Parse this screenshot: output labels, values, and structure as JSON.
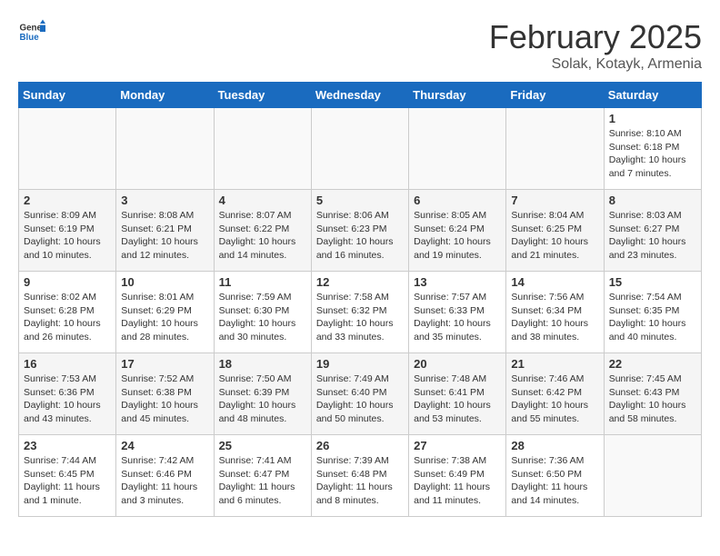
{
  "header": {
    "logo_general": "General",
    "logo_blue": "Blue",
    "title": "February 2025",
    "subtitle": "Solak, Kotayk, Armenia"
  },
  "weekdays": [
    "Sunday",
    "Monday",
    "Tuesday",
    "Wednesday",
    "Thursday",
    "Friday",
    "Saturday"
  ],
  "weeks": [
    [
      {
        "day": "",
        "info": ""
      },
      {
        "day": "",
        "info": ""
      },
      {
        "day": "",
        "info": ""
      },
      {
        "day": "",
        "info": ""
      },
      {
        "day": "",
        "info": ""
      },
      {
        "day": "",
        "info": ""
      },
      {
        "day": "1",
        "info": "Sunrise: 8:10 AM\nSunset: 6:18 PM\nDaylight: 10 hours and 7 minutes."
      }
    ],
    [
      {
        "day": "2",
        "info": "Sunrise: 8:09 AM\nSunset: 6:19 PM\nDaylight: 10 hours and 10 minutes."
      },
      {
        "day": "3",
        "info": "Sunrise: 8:08 AM\nSunset: 6:21 PM\nDaylight: 10 hours and 12 minutes."
      },
      {
        "day": "4",
        "info": "Sunrise: 8:07 AM\nSunset: 6:22 PM\nDaylight: 10 hours and 14 minutes."
      },
      {
        "day": "5",
        "info": "Sunrise: 8:06 AM\nSunset: 6:23 PM\nDaylight: 10 hours and 16 minutes."
      },
      {
        "day": "6",
        "info": "Sunrise: 8:05 AM\nSunset: 6:24 PM\nDaylight: 10 hours and 19 minutes."
      },
      {
        "day": "7",
        "info": "Sunrise: 8:04 AM\nSunset: 6:25 PM\nDaylight: 10 hours and 21 minutes."
      },
      {
        "day": "8",
        "info": "Sunrise: 8:03 AM\nSunset: 6:27 PM\nDaylight: 10 hours and 23 minutes."
      }
    ],
    [
      {
        "day": "9",
        "info": "Sunrise: 8:02 AM\nSunset: 6:28 PM\nDaylight: 10 hours and 26 minutes."
      },
      {
        "day": "10",
        "info": "Sunrise: 8:01 AM\nSunset: 6:29 PM\nDaylight: 10 hours and 28 minutes."
      },
      {
        "day": "11",
        "info": "Sunrise: 7:59 AM\nSunset: 6:30 PM\nDaylight: 10 hours and 30 minutes."
      },
      {
        "day": "12",
        "info": "Sunrise: 7:58 AM\nSunset: 6:32 PM\nDaylight: 10 hours and 33 minutes."
      },
      {
        "day": "13",
        "info": "Sunrise: 7:57 AM\nSunset: 6:33 PM\nDaylight: 10 hours and 35 minutes."
      },
      {
        "day": "14",
        "info": "Sunrise: 7:56 AM\nSunset: 6:34 PM\nDaylight: 10 hours and 38 minutes."
      },
      {
        "day": "15",
        "info": "Sunrise: 7:54 AM\nSunset: 6:35 PM\nDaylight: 10 hours and 40 minutes."
      }
    ],
    [
      {
        "day": "16",
        "info": "Sunrise: 7:53 AM\nSunset: 6:36 PM\nDaylight: 10 hours and 43 minutes."
      },
      {
        "day": "17",
        "info": "Sunrise: 7:52 AM\nSunset: 6:38 PM\nDaylight: 10 hours and 45 minutes."
      },
      {
        "day": "18",
        "info": "Sunrise: 7:50 AM\nSunset: 6:39 PM\nDaylight: 10 hours and 48 minutes."
      },
      {
        "day": "19",
        "info": "Sunrise: 7:49 AM\nSunset: 6:40 PM\nDaylight: 10 hours and 50 minutes."
      },
      {
        "day": "20",
        "info": "Sunrise: 7:48 AM\nSunset: 6:41 PM\nDaylight: 10 hours and 53 minutes."
      },
      {
        "day": "21",
        "info": "Sunrise: 7:46 AM\nSunset: 6:42 PM\nDaylight: 10 hours and 55 minutes."
      },
      {
        "day": "22",
        "info": "Sunrise: 7:45 AM\nSunset: 6:43 PM\nDaylight: 10 hours and 58 minutes."
      }
    ],
    [
      {
        "day": "23",
        "info": "Sunrise: 7:44 AM\nSunset: 6:45 PM\nDaylight: 11 hours and 1 minute."
      },
      {
        "day": "24",
        "info": "Sunrise: 7:42 AM\nSunset: 6:46 PM\nDaylight: 11 hours and 3 minutes."
      },
      {
        "day": "25",
        "info": "Sunrise: 7:41 AM\nSunset: 6:47 PM\nDaylight: 11 hours and 6 minutes."
      },
      {
        "day": "26",
        "info": "Sunrise: 7:39 AM\nSunset: 6:48 PM\nDaylight: 11 hours and 8 minutes."
      },
      {
        "day": "27",
        "info": "Sunrise: 7:38 AM\nSunset: 6:49 PM\nDaylight: 11 hours and 11 minutes."
      },
      {
        "day": "28",
        "info": "Sunrise: 7:36 AM\nSunset: 6:50 PM\nDaylight: 11 hours and 14 minutes."
      },
      {
        "day": "",
        "info": ""
      }
    ]
  ]
}
